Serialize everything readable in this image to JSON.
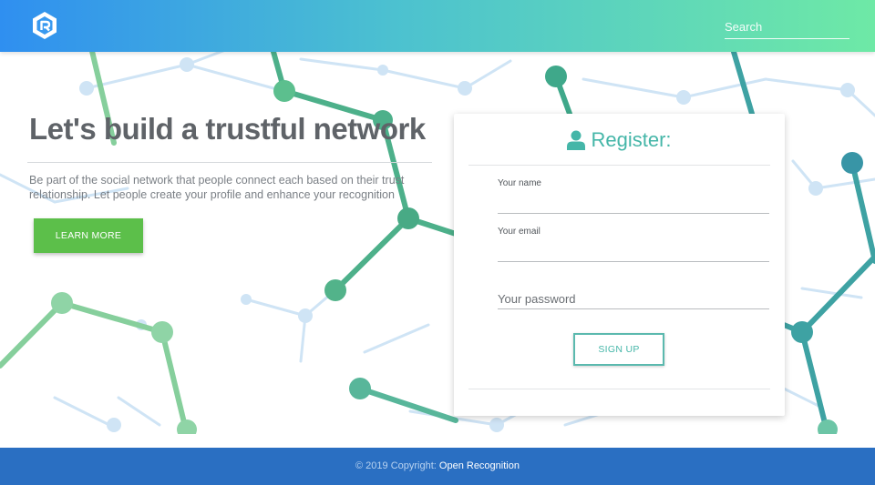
{
  "header": {
    "search_placeholder": "Search"
  },
  "hero": {
    "title": "Let's build a trustful network",
    "description": "Be part of the social network that people connect each based on their trust relationship. Let people create your profile and enhance your recognition",
    "learn_more_label": "LEARN MORE"
  },
  "register": {
    "title": "Register:",
    "name_label": "Your name",
    "email_label": "Your email",
    "password_placeholder": "Your password",
    "signup_label": "SIGN UP"
  },
  "footer": {
    "copyright": "© 2019 Copyright:",
    "link": "Open Recognition"
  },
  "colors": {
    "header_gradient_start": "#2f8ff0",
    "header_gradient_end": "#6ee9a6",
    "accent_teal": "#45b6a8",
    "learn_more_green": "#5cbf4a",
    "footer_blue": "#2a6fc2"
  },
  "icons": {
    "logo": "hexagon-r-logo",
    "register": "user-icon"
  }
}
